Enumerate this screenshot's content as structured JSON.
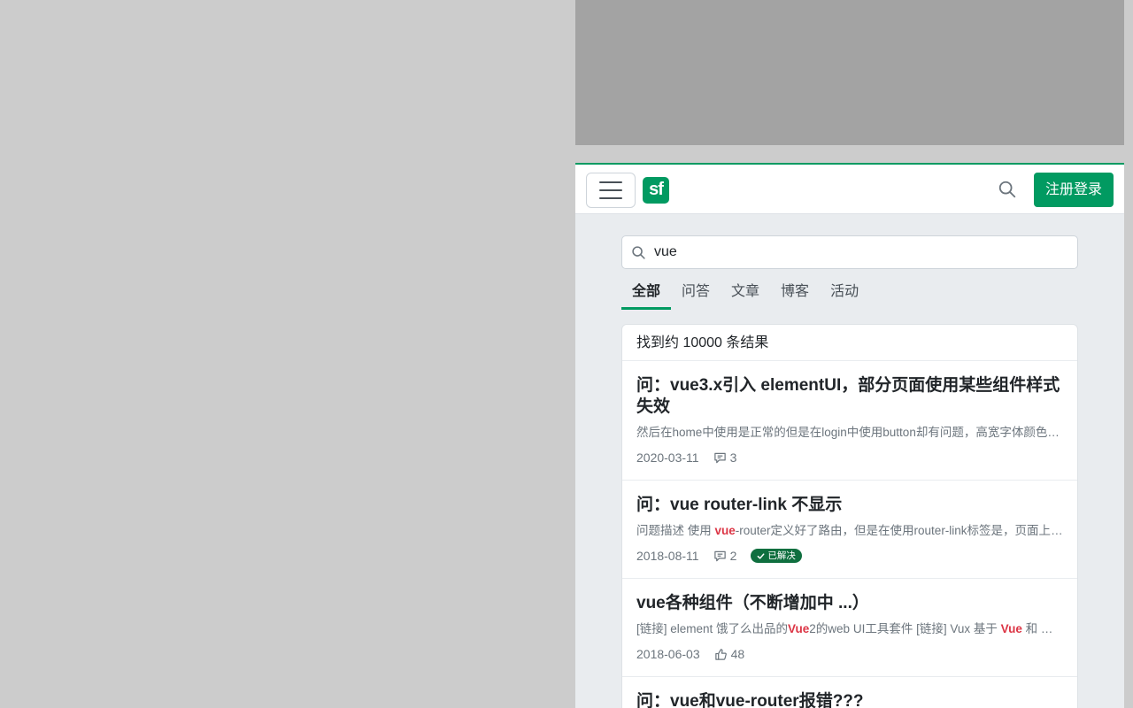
{
  "navbar": {
    "logo_text": "sf",
    "signup_login_label": "注册登录",
    "accent_color": "#019a61"
  },
  "search": {
    "value": "vue",
    "placeholder": ""
  },
  "tabs": [
    {
      "label": "全部",
      "active": true
    },
    {
      "label": "问答",
      "active": false
    },
    {
      "label": "文章",
      "active": false
    },
    {
      "label": "博客",
      "active": false
    },
    {
      "label": "活动",
      "active": false
    }
  ],
  "results": {
    "count_text": "找到约 10000 条结果",
    "items": [
      {
        "title": "问：vue3.x引入 elementUI，部分页面使用某些组件样式失效",
        "excerpt": "然后在home中使用是正常的但是在login中使用button却有问题，高宽字体颜色都失效了",
        "date": "2020-03-11",
        "stat_icon": "comment-icon",
        "stat_value": "3",
        "solved": false
      },
      {
        "title": "问：vue router-link 不显示",
        "excerpt_pre": "问题描述 使用 ",
        "excerpt_hl": "vue",
        "excerpt_post": "-router定义好了路由，但是在使用router-link标签是，页面上不显示",
        "date": "2018-08-11",
        "stat_icon": "comment-icon",
        "stat_value": "2",
        "solved": true,
        "solved_label": "已解决"
      },
      {
        "title": "vue各种组件（不断增加中 ...）",
        "excerpt_pre": "[链接] element 饿了么出品的",
        "excerpt_hl": "Vue",
        "excerpt_mid": "2的web UI工具套件 [链接] Vux 基于 ",
        "excerpt_hl2": "Vue",
        "excerpt_post": " 和 WeUI 的组件库",
        "date": "2018-06-03",
        "stat_icon": "thumbs-up-icon",
        "stat_value": "48",
        "solved": false
      },
      {
        "title": "问：vue和vue-router报错???"
      }
    ]
  }
}
